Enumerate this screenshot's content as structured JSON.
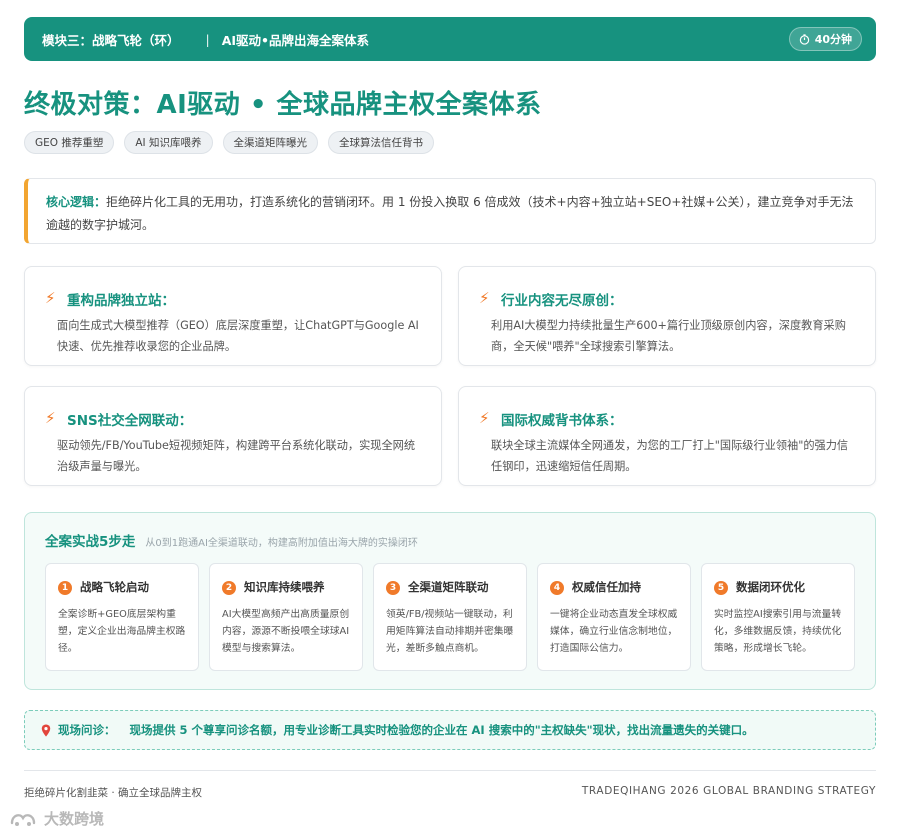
{
  "header": {
    "module": "模块三：战略飞轮（环）",
    "separator": "|",
    "topic": "AI驱动•品牌出海全案体系",
    "duration": "40分钟",
    "duration_icon": "timer-icon"
  },
  "title": "终极对策：AI驱动 • 全球品牌主权全案体系",
  "tags": [
    "GEO 推荐重塑",
    "AI 知识库喂养",
    "全渠道矩阵曝光",
    "全球算法信任背书"
  ],
  "core_logic": {
    "label": "核心逻辑：",
    "text": "拒绝碎片化工具的无用功，打造系统化的营销闭环。用 1 份投入换取 6 倍成效（技术+内容+独立站+SEO+社媒+公关），建立竞争对手无法逾越的数字护城河。"
  },
  "cards": [
    {
      "icon": "lightning-icon",
      "title": "重构品牌独立站：",
      "desc": "面向生成式大模型推荐（GEO）底层深度重塑，让ChatGPT与Google AI快速、优先推荐收录您的企业品牌。"
    },
    {
      "icon": "lightning-icon",
      "title": "行业内容无尽原创：",
      "desc": "利用AI大模型力持续批量生产600+篇行业顶级原创内容，深度教育采购商，全天候\"喂养\"全球搜索引擎算法。"
    },
    {
      "icon": "lightning-icon",
      "title": "SNS社交全网联动：",
      "desc": "驱动领先/FB/YouTube短视频矩阵，构建跨平台系统化联动，实现全网统治级声量与曝光。"
    },
    {
      "icon": "lightning-icon",
      "title": "国际权威背书体系：",
      "desc": "联块全球主流媒体全网通发，为您的工厂打上\"国际级行业领袖\"的强力信任钢印，迅速缩短信任周期。"
    }
  ],
  "steps": {
    "title": "全案实战5步走",
    "subtitle": "从0到1跑通AI全渠道联动，构建高附加值出海大牌的实操闭环",
    "items": [
      {
        "num": "1",
        "title": "战略飞轮启动",
        "desc": "全案诊断+GEO底层架构重塑，定义企业出海品牌主权路径。"
      },
      {
        "num": "2",
        "title": "知识库持续喂养",
        "desc": "AI大模型高频产出高质量原创内容，源源不断投喂全球球AI模型与搜索算法。"
      },
      {
        "num": "3",
        "title": "全渠道矩阵联动",
        "desc": "领英/FB/视频站一键联动，利用矩阵算法自动排期并密集曝光，差断多触点商机。"
      },
      {
        "num": "4",
        "title": "权威信任加持",
        "desc": "一键将企业动态直发全球权威媒体，确立行业信念制地位，打造国际公信力。"
      },
      {
        "num": "5",
        "title": "数据闭环优化",
        "desc": "实时监控AI搜索引用与流量转化，多维数据反馈，持续优化策略，形成增长飞轮。"
      }
    ]
  },
  "live": {
    "icon": "pin-icon",
    "label": "现场问诊：",
    "text": "现场提供 5 个尊享问诊名额，用专业诊断工具实时检验您的企业在 AI 搜索中的\"主权缺失\"现状，找出流量遗失的关键口。"
  },
  "footer": {
    "left": "拒绝碎片化割韭菜 · 确立全球品牌主权",
    "right": "TRADEQIHANG 2026 GLOBAL BRANDING STRATEGY"
  },
  "watermark": {
    "icon": "watermark-logo-icon",
    "text": "大数跨境"
  },
  "colors": {
    "accent": "#17927f",
    "highlight": "#f07a2a",
    "logic_border": "#f2a531"
  }
}
